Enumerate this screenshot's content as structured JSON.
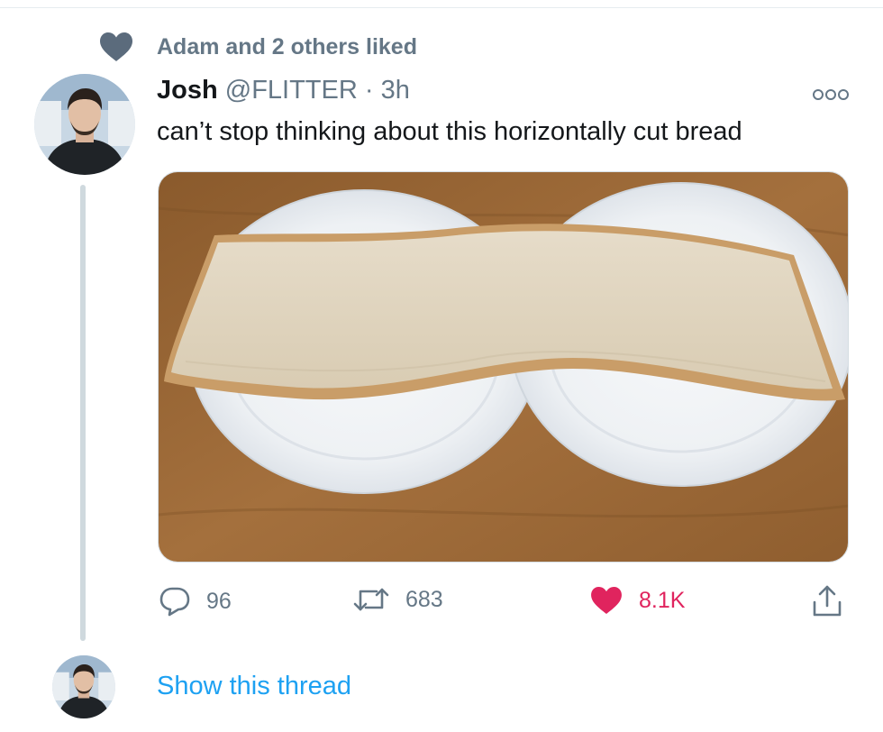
{
  "social_context": {
    "icon": "heart-icon",
    "text": "Adam and 2 others liked"
  },
  "tweet": {
    "display_name": "Josh",
    "handle": "@FLITTER",
    "separator": "·",
    "timestamp": "3h",
    "text": "can’t stop thinking about this horizontally cut bread",
    "more_icon": "more-options-icon",
    "media_icon": "photo-bread-on-plates"
  },
  "actions": {
    "reply": {
      "icon": "reply-icon",
      "count": "96"
    },
    "retweet": {
      "icon": "retweet-icon",
      "count": "683"
    },
    "like": {
      "icon": "heart-filled-icon",
      "count": "8.1K",
      "liked": true
    },
    "share": {
      "icon": "share-icon"
    }
  },
  "thread": {
    "show_label": "Show this thread"
  },
  "colors": {
    "secondary_text": "#657786",
    "link": "#1da1f2",
    "like": "#e0245e",
    "thread_line": "#cfd9de",
    "social_heart": "#5b6b7c"
  }
}
